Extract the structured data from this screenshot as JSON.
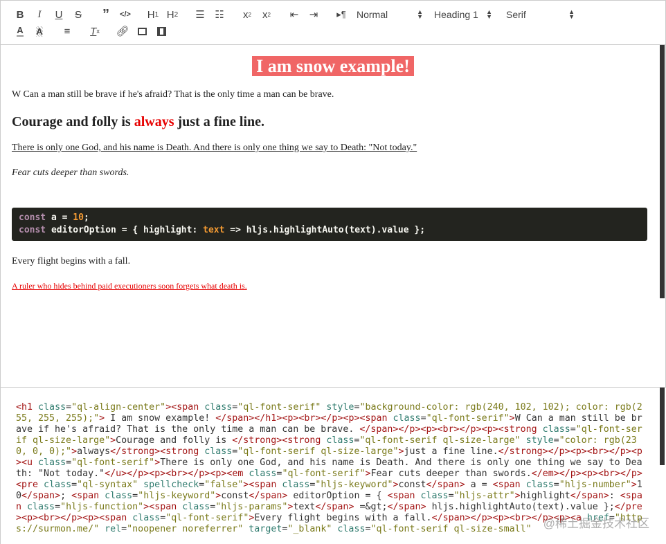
{
  "toolbar": {
    "format_select": "Normal",
    "heading_select": "Heading 1",
    "font_select": "Serif",
    "buttons": [
      "bold",
      "italic",
      "underline",
      "strike",
      "blockquote",
      "code-block",
      "header-1",
      "header-2",
      "ordered-list",
      "bullet-list",
      "subscript",
      "superscript",
      "outdent",
      "indent",
      "direction",
      "color",
      "background",
      "align",
      "clean",
      "link",
      "image",
      "video"
    ]
  },
  "editor": {
    "title": "I am snow example!",
    "p1": "W Can a man still be brave if he's afraid? That is the only time a man can be brave.",
    "p2a": "Courage and folly is ",
    "p2b": "always",
    "p2c": " just a fine line.",
    "p3": "There is only one God, and his name is Death. And there is only one thing we say to Death: \"Not today.\"",
    "p4": "Fear cuts deeper than swords.",
    "code": {
      "kw": "const",
      "l1a": " a = ",
      "num": "10",
      "l1b": ";",
      "l2a": " editorOption = { highlight: ",
      "param": "text",
      "l2b": " => hljs.highlightAuto(text).value };"
    },
    "p5": "Every flight begins with a fall.",
    "link": "A ruler who hides behind paid executioners soon forgets what death is. "
  },
  "output": {
    "html": "<h1 class=\"ql-align-center\"><span class=\"ql-font-serif\" style=\"background-color: rgb(240, 102, 102); color: rgb(255, 255, 255);\"> I am snow example! </span></h1><p><br></p><p><span class=\"ql-font-serif\">W Can a man still be brave if he's afraid? That is the only time a man can be brave. </span></p><p><br></p><p><strong class=\"ql-font-serif ql-size-large\">Courage and folly is </strong><strong class=\"ql-font-serif ql-size-large\" style=\"color: rgb(230, 0, 0);\">always</strong><strong class=\"ql-font-serif ql-size-large\">just a fine line.</strong></p><p><br></p><p><u class=\"ql-font-serif\">There is only one God, and his name is Death. And there is only one thing we say to Death: \"Not today.\"</u></p><p><br></p><p><em class=\"ql-font-serif\">Fear cuts deeper than swords.</em></p><p><br></p><pre class=\"ql-syntax\" spellcheck=\"false\"><span class=\"hljs-keyword\">const</span> a = <span class=\"hljs-number\">10</span>; <span class=\"hljs-keyword\">const</span> editorOption = { <span class=\"hljs-attr\">highlight</span>: <span class=\"hljs-function\"><span class=\"hljs-params\">text</span> =&gt;</span> hljs.highlightAuto(text).value };</pre><p><br></p><p><span class=\"ql-font-serif\">Every flight begins with a fall.</span></p><p><br></p><p><a href=\"https://surmon.me/\" rel=\"noopener noreferrer\" target=\"_blank\" class=\"ql-font-serif ql-size-small\""
  },
  "watermark": "@稀土掘金技术社区"
}
